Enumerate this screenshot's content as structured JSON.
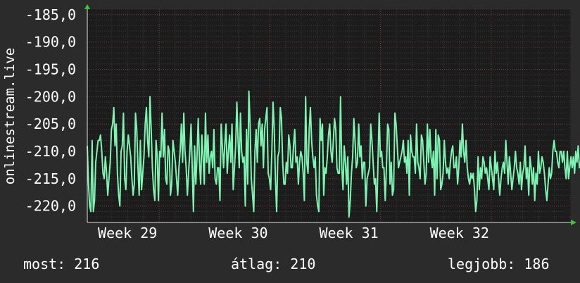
{
  "chart_data": {
    "type": "line",
    "ylabel": "onlinestream.live",
    "ylim": [
      -223.0,
      -184.0
    ],
    "y_ticks": [
      -185.0,
      -190.0,
      -195.0,
      -200.0,
      -205.0,
      -210.0,
      -215.0,
      -220.0
    ],
    "y_tick_labels": [
      "-185,0",
      "-190,0",
      "-195,0",
      "-200,0",
      "-205,0",
      "-210,0",
      "-215,0",
      "-220,0"
    ],
    "x_ticks": [
      {
        "label": "Week 29",
        "x": 29
      },
      {
        "label": "Week 30",
        "x": 30
      },
      {
        "label": "Week 31",
        "x": 31
      },
      {
        "label": "Week 32",
        "x": 32
      }
    ],
    "xlim": [
      28.35,
      32.72
    ],
    "grid": true,
    "series": [
      {
        "color": "#7cf5b3",
        "x_start": 28.35,
        "x_step": 0.0109,
        "values": [
          -209,
          -216,
          -220,
          -221,
          -208,
          -221,
          -219,
          -212,
          -210,
          -208,
          -208,
          -207,
          -210,
          -214,
          -215,
          -211,
          -214,
          -218,
          -215,
          -212,
          -206,
          -205,
          -202,
          -209,
          -205,
          -214,
          -218,
          -220,
          -210,
          -209,
          -203,
          -215,
          -217,
          -210,
          -207,
          -209,
          -211,
          -215,
          -218,
          -216,
          -203,
          -206,
          -213,
          -218,
          -208,
          -217,
          -214,
          -211,
          -205,
          -202,
          -208,
          -211,
          -200,
          -206,
          -213,
          -217,
          -219,
          -208,
          -211,
          -219,
          -210,
          -211,
          -203,
          -211,
          -206,
          -215,
          -216,
          -209,
          -210,
          -218,
          -216,
          -208,
          -210,
          -212,
          -215,
          -218,
          -213,
          -210,
          -205,
          -212,
          -203,
          -210,
          -213,
          -218,
          -214,
          -210,
          -205,
          -213,
          -221,
          -209,
          -216,
          -211,
          -204,
          -212,
          -216,
          -207,
          -211,
          -216,
          -203,
          -212,
          -207,
          -214,
          -211,
          -210,
          -213,
          -206,
          -215,
          -216,
          -213,
          -213,
          -219,
          -205,
          -209,
          -213,
          -209,
          -205,
          -214,
          -210,
          -207,
          -212,
          -205,
          -217,
          -213,
          -209,
          -201,
          -208,
          -213,
          -203,
          -210,
          -212,
          -211,
          -220,
          -206,
          -216,
          -199,
          -205,
          -215,
          -218,
          -221,
          -210,
          -206,
          -212,
          -205,
          -204,
          -209,
          -205,
          -213,
          -206,
          -204,
          -202,
          -214,
          -215,
          -217,
          -210,
          -201,
          -206,
          -215,
          -221,
          -211,
          -210,
          -202,
          -204,
          -212,
          -216,
          -216,
          -212,
          -214,
          -207,
          -209,
          -213,
          -213,
          -209,
          -206,
          -212,
          -211,
          -216,
          -212,
          -210,
          -211,
          -214,
          -219,
          -200,
          -212,
          -214,
          -206,
          -202,
          -208,
          -211,
          -213,
          -211,
          -218,
          -220,
          -221,
          -204,
          -208,
          -205,
          -218,
          -213,
          -214,
          -211,
          -207,
          -205,
          -210,
          -212,
          -208,
          -204,
          -206,
          -213,
          -214,
          -214,
          -200,
          -213,
          -217,
          -209,
          -212,
          -216,
          -211,
          -222,
          -219,
          -214,
          -211,
          -204,
          -208,
          -213,
          -212,
          -205,
          -211,
          -209,
          -215,
          -212,
          -212,
          -220,
          -215,
          -214,
          -213,
          -205,
          -208,
          -212,
          -216,
          -215,
          -221,
          -212,
          -203,
          -211,
          -210,
          -213,
          -213,
          -219,
          -213,
          -205,
          -206,
          -216,
          -212,
          -218,
          -217,
          -203,
          -205,
          -209,
          -213,
          -212,
          -211,
          -210,
          -208,
          -212,
          -211,
          -214,
          -208,
          -218,
          -207,
          -210,
          -211,
          -211,
          -214,
          -205,
          -212,
          -213,
          -215,
          -207,
          -208,
          -212,
          -216,
          -214,
          -205,
          -212,
          -206,
          -211,
          -213,
          -210,
          -218,
          -206,
          -215,
          -207,
          -208,
          -217,
          -216,
          -214,
          -208,
          -212,
          -214,
          -213,
          -215,
          -212,
          -210,
          -209,
          -213,
          -213,
          -211,
          -216,
          -213,
          -208,
          -211,
          -205,
          -210,
          -212,
          -208,
          -213,
          -215,
          -216,
          -214,
          -215,
          -214,
          -217,
          -221,
          -219,
          -211,
          -217,
          -213,
          -215,
          -211,
          -212,
          -214,
          -213,
          -215,
          -217,
          -211,
          -213,
          -215,
          -217,
          -210,
          -214,
          -212,
          -215,
          -218,
          -215,
          -213,
          -212,
          -214,
          -208,
          -212,
          -216,
          -211,
          -214,
          -217,
          -215,
          -213,
          -210,
          -213,
          -214,
          -216,
          -212,
          -217,
          -214,
          -213,
          -209,
          -215,
          -213,
          -218,
          -211,
          -213,
          -216,
          -213,
          -219,
          -214,
          -216,
          -210,
          -214,
          -213,
          -211,
          -212,
          -214,
          -217,
          -219,
          -216,
          -213,
          -215,
          -214,
          -210,
          -208,
          -210,
          -210,
          -212,
          -213,
          -210,
          -210,
          -212,
          -210,
          -213,
          -215,
          -210,
          -215,
          -213,
          -211,
          -213,
          -211,
          -214,
          -210,
          -212,
          -209,
          -213,
          -212,
          -212,
          -210,
          -215,
          -219,
          -217,
          -219,
          -219,
          -214,
          -216,
          -213,
          -215,
          -213,
          -212,
          -211,
          -213,
          -212,
          -214,
          -218,
          -217,
          -219,
          -214,
          -218,
          -215,
          -214,
          -214,
          -216,
          -216,
          -213,
          -215,
          -215,
          -213,
          -215,
          -213,
          -214,
          -212,
          -212,
          -212,
          -211,
          -212,
          -211,
          -214,
          -213,
          -212,
          -212,
          -214,
          -213,
          -212,
          -214,
          -216,
          -217,
          -219,
          -214,
          -219,
          -219,
          -217,
          -214,
          -216,
          -215,
          -219,
          -219,
          -214,
          -219,
          -219,
          -220,
          -214,
          -213,
          -216,
          -210,
          -212,
          -216,
          -215,
          -219,
          -219,
          -216,
          -213,
          -214,
          -212,
          -210,
          -212,
          -211,
          -212
        ]
      }
    ],
    "legend": "none"
  },
  "stats": {
    "now": "most: 216",
    "avg": "átlag: 210",
    "best": "legjobb: 186"
  }
}
